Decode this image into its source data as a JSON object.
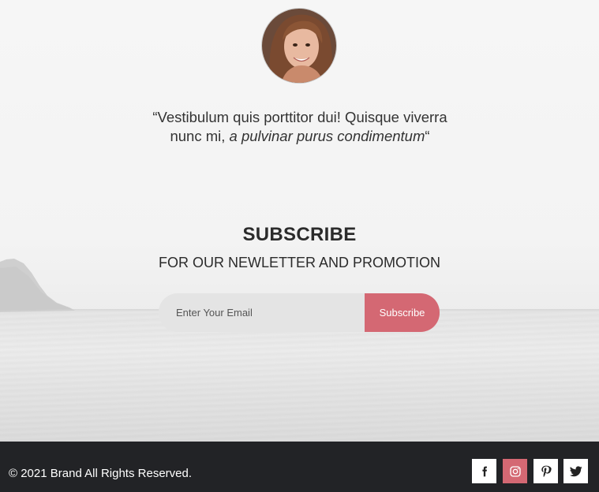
{
  "testimonial": {
    "quote_plain": "“Vestibulum quis porttitor dui! Quisque viverra nunc mi, ",
    "quote_italic": "a pulvinar purus condimentum",
    "quote_close": "“"
  },
  "subscribe": {
    "title": "SUBSCRIBE",
    "subtitle": "FOR OUR NEWLETTER AND PROMOTION",
    "email_placeholder": "Enter Your Email",
    "button_label": "Subscribe"
  },
  "footer": {
    "copyright": "© 2021 Brand All Rights Reserved.",
    "social": [
      {
        "icon": "facebook-icon"
      },
      {
        "icon": "instagram-icon"
      },
      {
        "icon": "pinterest-icon"
      },
      {
        "icon": "twitter-icon"
      }
    ]
  },
  "colors": {
    "accent": "#d46873",
    "footer_bg": "#222326",
    "input_bg": "#e4e4e4"
  }
}
